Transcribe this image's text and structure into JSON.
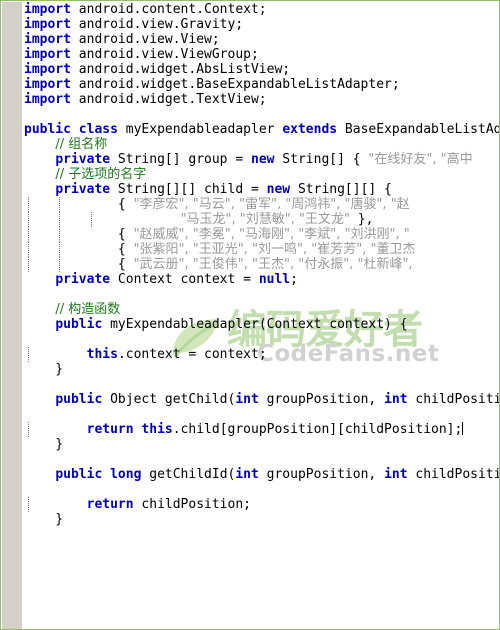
{
  "editor": {
    "background_color": "#ffffff",
    "gutter_color": "#d4d0c8",
    "border_color": "#8fbf6a",
    "keyword_color": "#0000c0",
    "comment_color": "#1e7a1e",
    "string_color": "#9a9a9a",
    "text_color": "#000000",
    "language": "Java",
    "caret_line_index": 34
  },
  "watermark": {
    "chinese_text": "编码爱好者",
    "site_text": "CodeFans.net",
    "color": "#b9d9a0",
    "site_color": "#c9c9c9"
  },
  "code_lines": [
    {
      "indent": 0,
      "guides": 0,
      "tokens": [
        {
          "t": "import",
          "c": "kw"
        },
        {
          "t": " android.content.Context;",
          "c": "plain"
        }
      ]
    },
    {
      "indent": 0,
      "guides": 0,
      "tokens": [
        {
          "t": "import",
          "c": "kw"
        },
        {
          "t": " android.view.Gravity;",
          "c": "plain"
        }
      ]
    },
    {
      "indent": 0,
      "guides": 0,
      "tokens": [
        {
          "t": "import",
          "c": "kw"
        },
        {
          "t": " android.view.View;",
          "c": "plain"
        }
      ]
    },
    {
      "indent": 0,
      "guides": 0,
      "tokens": [
        {
          "t": "import",
          "c": "kw"
        },
        {
          "t": " android.view.ViewGroup;",
          "c": "plain"
        }
      ]
    },
    {
      "indent": 0,
      "guides": 0,
      "tokens": [
        {
          "t": "import",
          "c": "kw"
        },
        {
          "t": " android.widget.AbsListView;",
          "c": "plain"
        }
      ]
    },
    {
      "indent": 0,
      "guides": 0,
      "tokens": [
        {
          "t": "import",
          "c": "kw"
        },
        {
          "t": " android.widget.BaseExpandableListAdapter;",
          "c": "plain"
        }
      ]
    },
    {
      "indent": 0,
      "guides": 0,
      "tokens": [
        {
          "t": "import",
          "c": "kw"
        },
        {
          "t": " android.widget.TextView;",
          "c": "plain"
        }
      ]
    },
    {
      "indent": 0,
      "guides": 0,
      "tokens": []
    },
    {
      "indent": 0,
      "guides": 0,
      "tokens": [
        {
          "t": "public",
          "c": "kw"
        },
        {
          "t": " ",
          "c": "plain"
        },
        {
          "t": "class",
          "c": "kw"
        },
        {
          "t": " myExpendableadapler ",
          "c": "plain"
        },
        {
          "t": "extends",
          "c": "kw"
        },
        {
          "t": " BaseExpandableListAd",
          "c": "plain"
        }
      ]
    },
    {
      "indent": 0,
      "guides": 0,
      "tokens": [
        {
          "t": "    ",
          "c": "plain"
        },
        {
          "t": "// 组名称",
          "c": "cmt cn"
        }
      ]
    },
    {
      "indent": 0,
      "guides": 0,
      "tokens": [
        {
          "t": "    ",
          "c": "plain"
        },
        {
          "t": "private",
          "c": "kw"
        },
        {
          "t": " String[] group = ",
          "c": "plain"
        },
        {
          "t": "new",
          "c": "kw"
        },
        {
          "t": " String[] { ",
          "c": "plain"
        },
        {
          "t": "\"在线好友\", \"高中",
          "c": "str cn"
        }
      ]
    },
    {
      "indent": 0,
      "guides": 0,
      "tokens": [
        {
          "t": "    ",
          "c": "plain"
        },
        {
          "t": "// 子选项的名字",
          "c": "cmt cn"
        }
      ]
    },
    {
      "indent": 0,
      "guides": 0,
      "tokens": [
        {
          "t": "    ",
          "c": "plain"
        },
        {
          "t": "private",
          "c": "kw"
        },
        {
          "t": " String[][] child = ",
          "c": "plain"
        },
        {
          "t": "new",
          "c": "kw"
        },
        {
          "t": " String[][] {",
          "c": "plain"
        }
      ]
    },
    {
      "indent": 0,
      "guides": 2,
      "tokens": [
        {
          "t": "            { ",
          "c": "plain"
        },
        {
          "t": "\"李彦宏\", \"马云\", \"雷军\", \"周鸿祎\", \"唐骏\", \"赵",
          "c": "str cn"
        }
      ]
    },
    {
      "indent": 0,
      "guides": 3,
      "tokens": [
        {
          "t": "                    ",
          "c": "plain"
        },
        {
          "t": "\"马玉龙\", \"刘慧敏\", \"王文龙\"",
          "c": "str cn"
        },
        {
          "t": " },",
          "c": "plain"
        }
      ]
    },
    {
      "indent": 0,
      "guides": 2,
      "tokens": [
        {
          "t": "            { ",
          "c": "plain"
        },
        {
          "t": "\"赵威威\", \"李冕\", \"马海刚\", \"李斌\", \"刘洪刚\", \"",
          "c": "str cn"
        }
      ]
    },
    {
      "indent": 0,
      "guides": 2,
      "tokens": [
        {
          "t": "            { ",
          "c": "plain"
        },
        {
          "t": "\"张紫阳\", \"王亚光\", \"刘一鸣\", \"崔芳芳\", \"董卫杰",
          "c": "str cn"
        }
      ]
    },
    {
      "indent": 0,
      "guides": 2,
      "tokens": [
        {
          "t": "            { ",
          "c": "plain"
        },
        {
          "t": "\"武云册\", \"王俊伟\", \"王杰\", \"付永振\", \"杜新峰\",",
          "c": "str cn"
        }
      ]
    },
    {
      "indent": 0,
      "guides": 0,
      "tokens": [
        {
          "t": "    ",
          "c": "plain"
        },
        {
          "t": "private",
          "c": "kw"
        },
        {
          "t": " Context context = ",
          "c": "plain"
        },
        {
          "t": "null",
          "c": "kw"
        },
        {
          "t": ";",
          "c": "plain"
        }
      ]
    },
    {
      "indent": 0,
      "guides": 0,
      "tokens": []
    },
    {
      "indent": 0,
      "guides": 0,
      "tokens": [
        {
          "t": "    ",
          "c": "plain"
        },
        {
          "t": "// 构造函数",
          "c": "cmt cn"
        }
      ]
    },
    {
      "indent": 0,
      "guides": 0,
      "tokens": [
        {
          "t": "    ",
          "c": "plain"
        },
        {
          "t": "public",
          "c": "kw"
        },
        {
          "t": " myExpendableadapler(Context context) {",
          "c": "plain"
        }
      ]
    },
    {
      "indent": 0,
      "guides": 0,
      "tokens": []
    },
    {
      "indent": 0,
      "guides": 1,
      "tokens": [
        {
          "t": "        ",
          "c": "plain"
        },
        {
          "t": "this",
          "c": "kw"
        },
        {
          "t": ".context = context;",
          "c": "plain"
        }
      ]
    },
    {
      "indent": 0,
      "guides": 0,
      "tokens": [
        {
          "t": "    }",
          "c": "plain"
        }
      ]
    },
    {
      "indent": 0,
      "guides": 0,
      "tokens": []
    },
    {
      "indent": 0,
      "guides": 0,
      "tokens": [
        {
          "t": "    ",
          "c": "plain"
        },
        {
          "t": "public",
          "c": "kw"
        },
        {
          "t": " Object getChild(",
          "c": "plain"
        },
        {
          "t": "int",
          "c": "kw"
        },
        {
          "t": " groupPosition, ",
          "c": "plain"
        },
        {
          "t": "int",
          "c": "kw"
        },
        {
          "t": " childPositi",
          "c": "plain"
        }
      ]
    },
    {
      "indent": 0,
      "guides": 0,
      "tokens": []
    },
    {
      "indent": 0,
      "guides": 1,
      "tokens": [
        {
          "t": "        ",
          "c": "plain"
        },
        {
          "t": "return",
          "c": "kw"
        },
        {
          "t": " ",
          "c": "plain"
        },
        {
          "t": "this",
          "c": "kw"
        },
        {
          "t": ".child[groupPosition][childPosition];",
          "c": "plain"
        },
        {
          "t": "CARET",
          "c": "caret"
        }
      ]
    },
    {
      "indent": 0,
      "guides": 0,
      "tokens": [
        {
          "t": "    }",
          "c": "plain"
        }
      ]
    },
    {
      "indent": 0,
      "guides": 0,
      "tokens": []
    },
    {
      "indent": 0,
      "guides": 0,
      "tokens": [
        {
          "t": "    ",
          "c": "plain"
        },
        {
          "t": "public",
          "c": "kw"
        },
        {
          "t": " ",
          "c": "plain"
        },
        {
          "t": "long",
          "c": "kw"
        },
        {
          "t": " getChildId(",
          "c": "plain"
        },
        {
          "t": "int",
          "c": "kw"
        },
        {
          "t": " groupPosition, ",
          "c": "plain"
        },
        {
          "t": "int",
          "c": "kw"
        },
        {
          "t": " childPositi",
          "c": "plain"
        }
      ]
    },
    {
      "indent": 0,
      "guides": 0,
      "tokens": []
    },
    {
      "indent": 0,
      "guides": 1,
      "tokens": [
        {
          "t": "        ",
          "c": "plain"
        },
        {
          "t": "return",
          "c": "kw"
        },
        {
          "t": " childPosition;",
          "c": "plain"
        }
      ]
    },
    {
      "indent": 0,
      "guides": 0,
      "tokens": [
        {
          "t": "    }",
          "c": "plain"
        }
      ]
    }
  ]
}
